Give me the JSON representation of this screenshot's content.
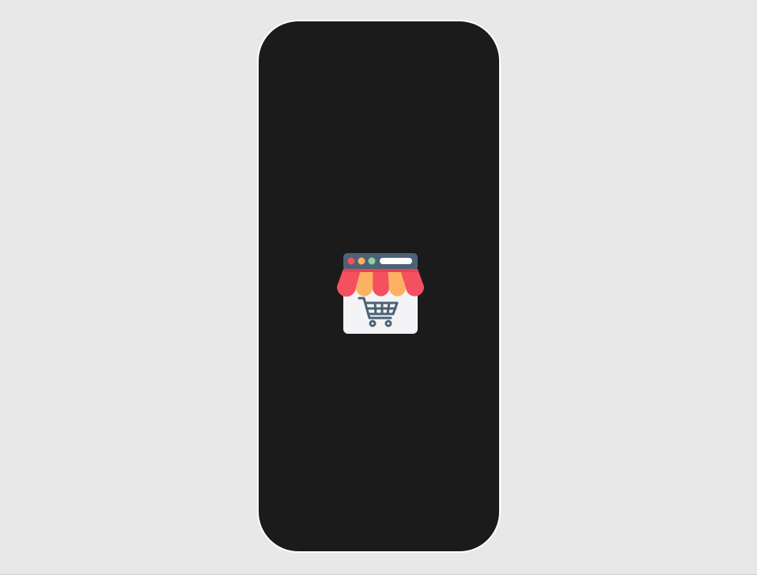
{
  "app": {
    "screen": "splash",
    "logo_icon": "storefront-cart-icon"
  },
  "colors": {
    "page_background": "#e8e8e8",
    "device_bezel": "#ffffff",
    "screen_background": "#1b1b1b",
    "awning_red": "#f4505f",
    "awning_orange": "#ffb163",
    "browser_bar": "#4c6275",
    "dot_red": "#f4505f",
    "dot_orange": "#ffb163",
    "dot_green": "#8ed1a6",
    "shop_body": "#f4f4f6",
    "cart": "#4c6275"
  }
}
